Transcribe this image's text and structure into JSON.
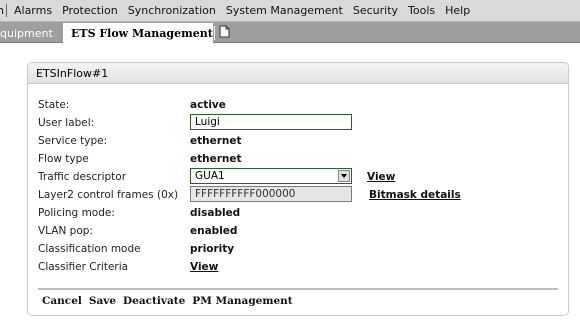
{
  "menubar": {
    "items": [
      {
        "label": "n"
      },
      {
        "label": "Alarms"
      },
      {
        "label": "Protection"
      },
      {
        "label": "Synchronization"
      },
      {
        "label": "System Management"
      },
      {
        "label": "Security"
      },
      {
        "label": "Tools"
      },
      {
        "label": "Help"
      }
    ]
  },
  "tabs": {
    "inactive_label": "quipment",
    "active_label": "ETS Flow Management",
    "new_tab_icon": "new-document-icon"
  },
  "panel": {
    "title": "ETSInFlow#1",
    "state": {
      "label": "State:",
      "value": "active"
    },
    "user_label": {
      "label": "User label:",
      "value": "Luigi"
    },
    "service_type": {
      "label": "Service type:",
      "value": "ethernet"
    },
    "flow_type": {
      "label": "Flow type",
      "value": "ethernet"
    },
    "traffic_descriptor": {
      "label": "Traffic descriptor",
      "selected": "GUA1",
      "link": "View"
    },
    "layer2": {
      "label": "Layer2 control frames (0x)",
      "value": "FFFFFFFFFF000000",
      "link": "Bitmask details"
    },
    "policing_mode": {
      "label": "Policing mode:",
      "value": "disabled"
    },
    "vlan_pop": {
      "label": "VLAN pop:",
      "value": "enabled"
    },
    "classification_mode": {
      "label": "Classification mode",
      "value": "priority"
    },
    "classifier_criteria": {
      "label": "Classifier Criteria",
      "link": "View"
    }
  },
  "actions": {
    "cancel": "Cancel",
    "save": "Save",
    "deactivate": "Deactivate",
    "pm_management": "PM Management"
  }
}
